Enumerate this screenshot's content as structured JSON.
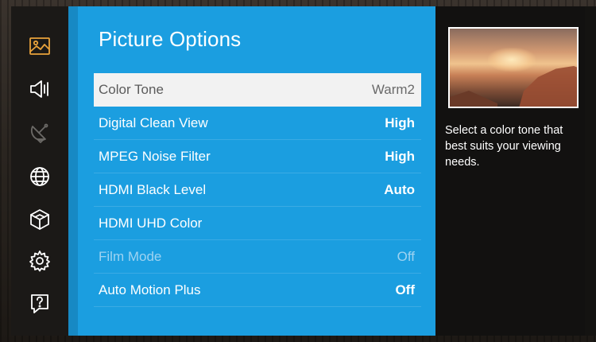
{
  "panel": {
    "title": "Picture Options"
  },
  "rail": {
    "items": [
      {
        "icon": "picture-icon",
        "state": "active"
      },
      {
        "icon": "sound-icon",
        "state": "normal"
      },
      {
        "icon": "broadcast-icon",
        "state": "dim"
      },
      {
        "icon": "network-icon",
        "state": "normal"
      },
      {
        "icon": "smart-hub-icon",
        "state": "normal"
      },
      {
        "icon": "gear-icon",
        "state": "normal"
      },
      {
        "icon": "support-icon",
        "state": "normal"
      }
    ]
  },
  "menu": {
    "items": [
      {
        "label": "Color Tone",
        "value": "Warm2",
        "state": "selected"
      },
      {
        "label": "Digital Clean View",
        "value": "High",
        "state": "normal"
      },
      {
        "label": "MPEG Noise Filter",
        "value": "High",
        "state": "normal"
      },
      {
        "label": "HDMI Black Level",
        "value": "Auto",
        "state": "normal"
      },
      {
        "label": "HDMI UHD Color",
        "value": "",
        "state": "normal"
      },
      {
        "label": "Film Mode",
        "value": "Off",
        "state": "disabled"
      },
      {
        "label": "Auto Motion Plus",
        "value": "Off",
        "state": "normal"
      }
    ]
  },
  "info": {
    "description": "Select a color tone that best suits your viewing needs."
  },
  "colors": {
    "accent": "#e9a23b",
    "panel_blue": "#1b9ee0",
    "selected_row": "#f2f2f2"
  }
}
